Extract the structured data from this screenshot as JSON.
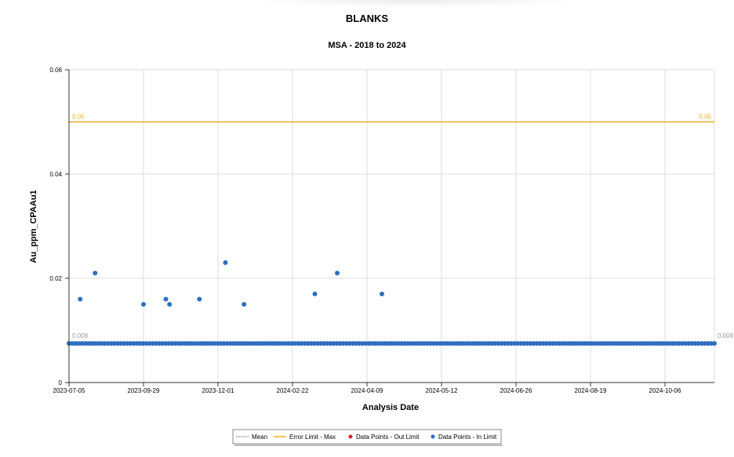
{
  "chart_data": {
    "type": "scatter",
    "title": "BLANKS",
    "subtitle": "MSA - 2018 to 2024",
    "xlabel": "Analysis Date",
    "ylabel": "Au_ppm_CPAAu1",
    "x_ticks": [
      "2023-07-05",
      "2023-09-29",
      "2023-12-01",
      "2024-02-22",
      "2024-04-09",
      "2024-05-12",
      "2024-06-26",
      "2024-08-19",
      "2024-10-06"
    ],
    "y_ticks": [
      "0",
      "0.02",
      "0.04",
      "0.06"
    ],
    "ylim": [
      0,
      0.06
    ],
    "grid": true,
    "reference_lines": [
      {
        "name": "Error Limit - Max",
        "value": 0.05,
        "label": "0.05",
        "color": "#e8b020"
      },
      {
        "name": "Mean",
        "value": 0.008,
        "label": "0.008",
        "color": "#999999"
      }
    ],
    "series": [
      {
        "name": "Data Points - In Limit",
        "color": "#2e6fbf",
        "points": [
          {
            "x": 1.5,
            "y": 0.016
          },
          {
            "x": 3.5,
            "y": 0.021
          },
          {
            "x": 10,
            "y": 0.015
          },
          {
            "x": 13,
            "y": 0.016
          },
          {
            "x": 13.5,
            "y": 0.015
          },
          {
            "x": 17.5,
            "y": 0.016
          },
          {
            "x": 21,
            "y": 0.023
          },
          {
            "x": 23.5,
            "y": 0.015
          },
          {
            "x": 33,
            "y": 0.017
          },
          {
            "x": 36,
            "y": 0.021
          },
          {
            "x": 42,
            "y": 0.017
          }
        ],
        "baseline_value": 0.0075,
        "baseline_count": 201
      },
      {
        "name": "Data Points - Out Limit",
        "color": "#e02020",
        "points": []
      }
    ],
    "legend": {
      "position": "bottom",
      "items": [
        {
          "label": "Mean",
          "type": "dotted",
          "color": "#555555"
        },
        {
          "label": "Error Limit - Max",
          "type": "line",
          "color": "#e8b020"
        },
        {
          "label": "Data Points - Out Limit",
          "type": "dot",
          "color": "#e02020"
        },
        {
          "label": "Data Points - In Limit",
          "type": "dot",
          "color": "#2e6fbf"
        }
      ]
    }
  }
}
